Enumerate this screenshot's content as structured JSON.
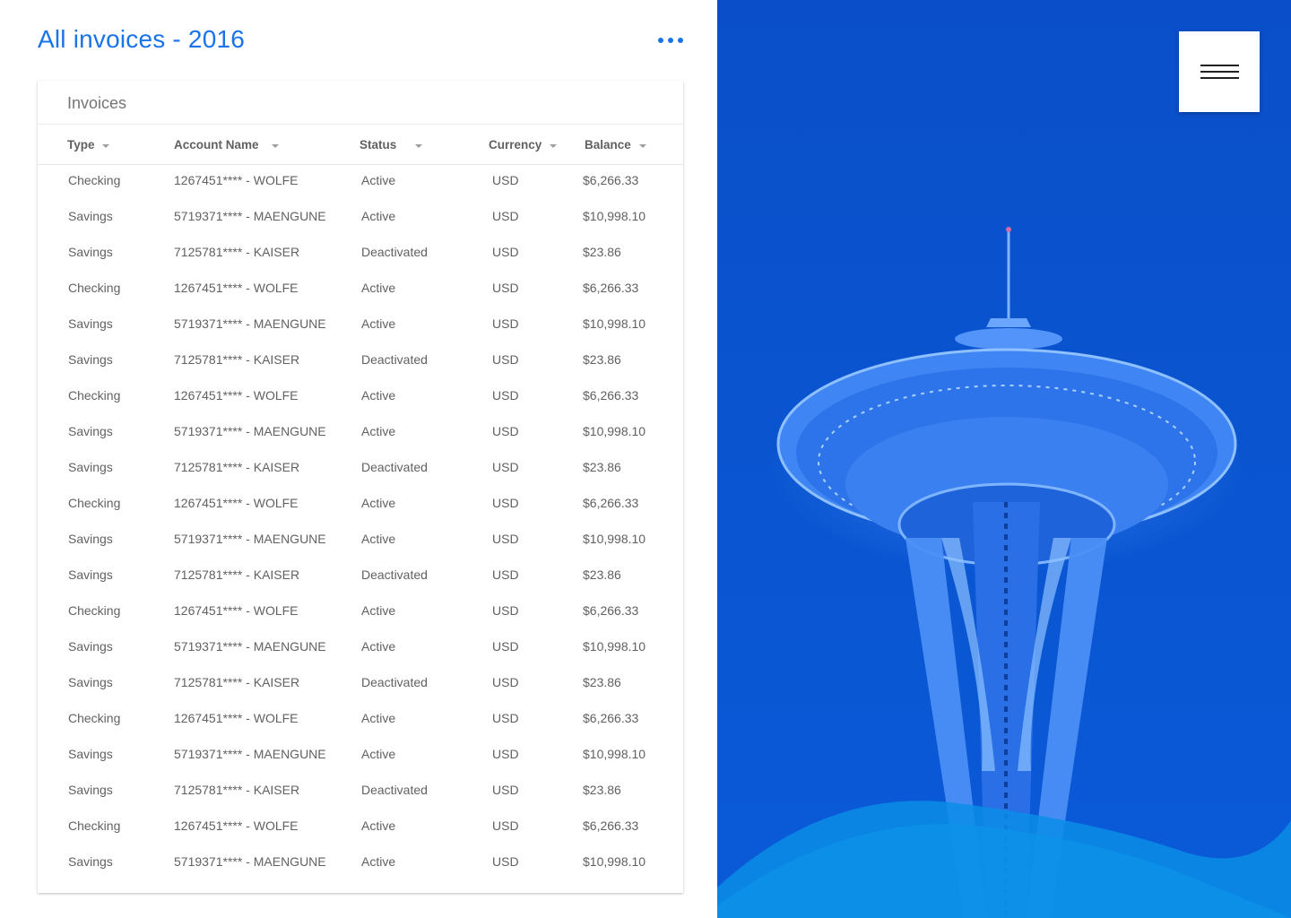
{
  "header": {
    "title": "All invoices - 2016",
    "more_icon": "more-horizontal-icon",
    "accent_color": "#1a73e8"
  },
  "card": {
    "title": "Invoices",
    "columns": [
      {
        "label": "Type",
        "sort_icon": "sort-down-icon"
      },
      {
        "label": "Account Name",
        "sort_icon": "sort-down-icon"
      },
      {
        "label": "Status",
        "sort_icon": "sort-down-icon"
      },
      {
        "label": "Currency",
        "sort_icon": "sort-down-icon"
      },
      {
        "label": "Balance",
        "sort_icon": "sort-down-icon"
      }
    ],
    "rows": [
      {
        "type": "Checking",
        "account": "1267451**** - WOLFE",
        "status": "Active",
        "currency": "USD",
        "balance": "$6,266.33"
      },
      {
        "type": "Savings",
        "account": "5719371**** - MAENGUNE",
        "status": "Active",
        "currency": "USD",
        "balance": "$10,998.10"
      },
      {
        "type": "Savings",
        "account": "7125781**** - KAISER",
        "status": "Deactivated",
        "currency": "USD",
        "balance": "$23.86"
      },
      {
        "type": "Checking",
        "account": "1267451**** - WOLFE",
        "status": "Active",
        "currency": "USD",
        "balance": "$6,266.33"
      },
      {
        "type": "Savings",
        "account": "5719371**** - MAENGUNE",
        "status": "Active",
        "currency": "USD",
        "balance": "$10,998.10"
      },
      {
        "type": "Savings",
        "account": "7125781**** - KAISER",
        "status": "Deactivated",
        "currency": "USD",
        "balance": "$23.86"
      },
      {
        "type": "Checking",
        "account": "1267451**** - WOLFE",
        "status": "Active",
        "currency": "USD",
        "balance": "$6,266.33"
      },
      {
        "type": "Savings",
        "account": "5719371**** - MAENGUNE",
        "status": "Active",
        "currency": "USD",
        "balance": "$10,998.10"
      },
      {
        "type": "Savings",
        "account": "7125781**** - KAISER",
        "status": "Deactivated",
        "currency": "USD",
        "balance": "$23.86"
      },
      {
        "type": "Checking",
        "account": "1267451**** - WOLFE",
        "status": "Active",
        "currency": "USD",
        "balance": "$6,266.33"
      },
      {
        "type": "Savings",
        "account": "5719371**** - MAENGUNE",
        "status": "Active",
        "currency": "USD",
        "balance": "$10,998.10"
      },
      {
        "type": "Savings",
        "account": "7125781**** - KAISER",
        "status": "Deactivated",
        "currency": "USD",
        "balance": "$23.86"
      },
      {
        "type": "Checking",
        "account": "1267451**** - WOLFE",
        "status": "Active",
        "currency": "USD",
        "balance": "$6,266.33"
      },
      {
        "type": "Savings",
        "account": "5719371**** - MAENGUNE",
        "status": "Active",
        "currency": "USD",
        "balance": "$10,998.10"
      },
      {
        "type": "Savings",
        "account": "7125781**** - KAISER",
        "status": "Deactivated",
        "currency": "USD",
        "balance": "$23.86"
      },
      {
        "type": "Checking",
        "account": "1267451**** - WOLFE",
        "status": "Active",
        "currency": "USD",
        "balance": "$6,266.33"
      },
      {
        "type": "Savings",
        "account": "5719371**** - MAENGUNE",
        "status": "Active",
        "currency": "USD",
        "balance": "$10,998.10"
      },
      {
        "type": "Savings",
        "account": "7125781**** - KAISER",
        "status": "Deactivated",
        "currency": "USD",
        "balance": "$23.86"
      },
      {
        "type": "Checking",
        "account": "1267451**** - WOLFE",
        "status": "Active",
        "currency": "USD",
        "balance": "$6,266.33"
      },
      {
        "type": "Savings",
        "account": "5719371**** - MAENGUNE",
        "status": "Active",
        "currency": "USD",
        "balance": "$10,998.10"
      }
    ]
  },
  "hero": {
    "image": "space-needle-blue-photo",
    "menu_icon": "hamburger-menu-icon",
    "background_color": "#0a55d6"
  }
}
